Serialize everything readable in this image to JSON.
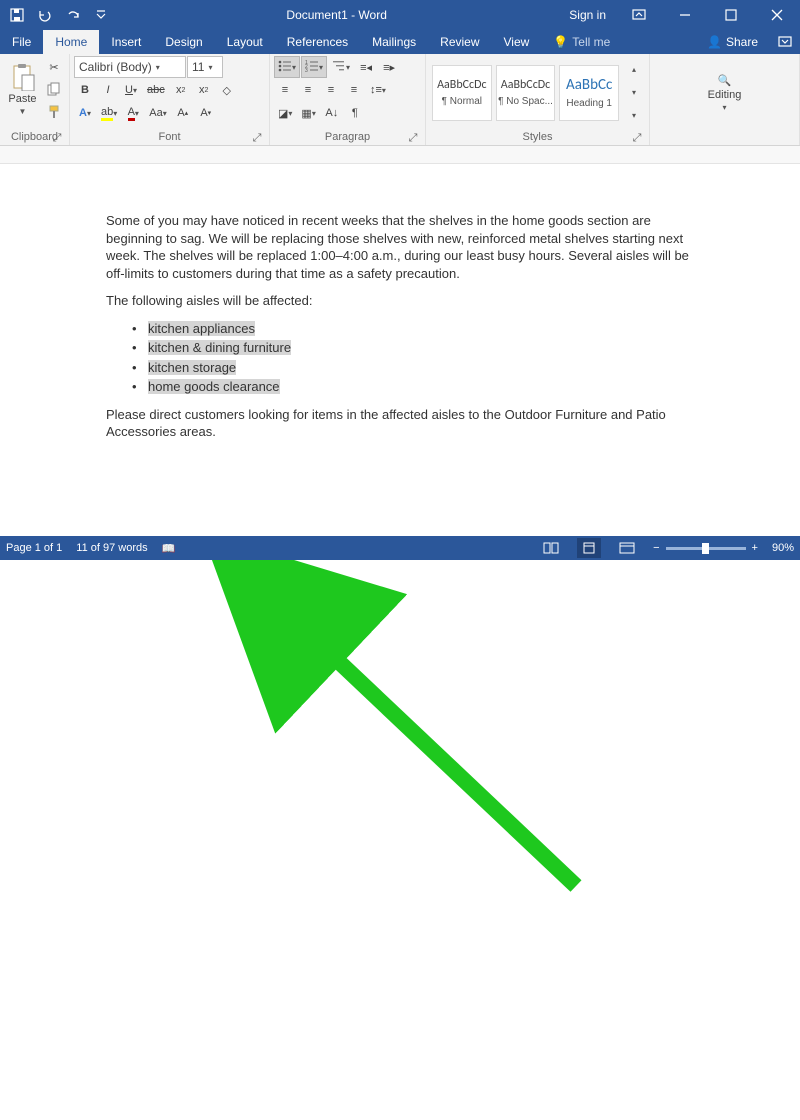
{
  "title": "Document1 - Word",
  "signin": "Sign in",
  "tabs": [
    "File",
    "Home",
    "Insert",
    "Design",
    "Layout",
    "References",
    "Mailings",
    "Review",
    "View"
  ],
  "active_tab": 1,
  "tell_me": "Tell me",
  "share": "Share",
  "ribbon": {
    "clipboard": {
      "paste": "Paste",
      "label": "Clipboard"
    },
    "font": {
      "name": "Calibri (Body)",
      "size": "11",
      "label": "Font"
    },
    "paragraph": {
      "label": "Paragrap"
    },
    "styles": {
      "label": "Styles",
      "items": [
        {
          "preview": "AaBbCcDc",
          "name": "¶ Normal"
        },
        {
          "preview": "AaBbCcDc",
          "name": "¶ No Spac..."
        },
        {
          "preview": "AaBbCc",
          "name": "Heading 1"
        }
      ]
    },
    "editing": {
      "label": "Editing"
    }
  },
  "document": {
    "p1": "Some of you may have noticed in recent weeks that the shelves in the home goods section are beginning to sag. We will be replacing those shelves with new, reinforced metal shelves starting next week. The shelves will be replaced 1:00–4:00 a.m., during our least busy hours. Several aisles will be off-limits to customers during that time as a safety precaution.",
    "p2": "The following aisles will be affected:",
    "li1": "kitchen appliances",
    "li2": "kitchen & dining furniture",
    "li3": "kitchen storage",
    "li4": "home goods clearance",
    "p3": "Please direct customers looking for items in the affected aisles to the Outdoor Furniture and Patio Accessories areas."
  },
  "status": {
    "page": "Page 1 of 1",
    "words": "11 of 97 words",
    "zoom": "90%"
  }
}
